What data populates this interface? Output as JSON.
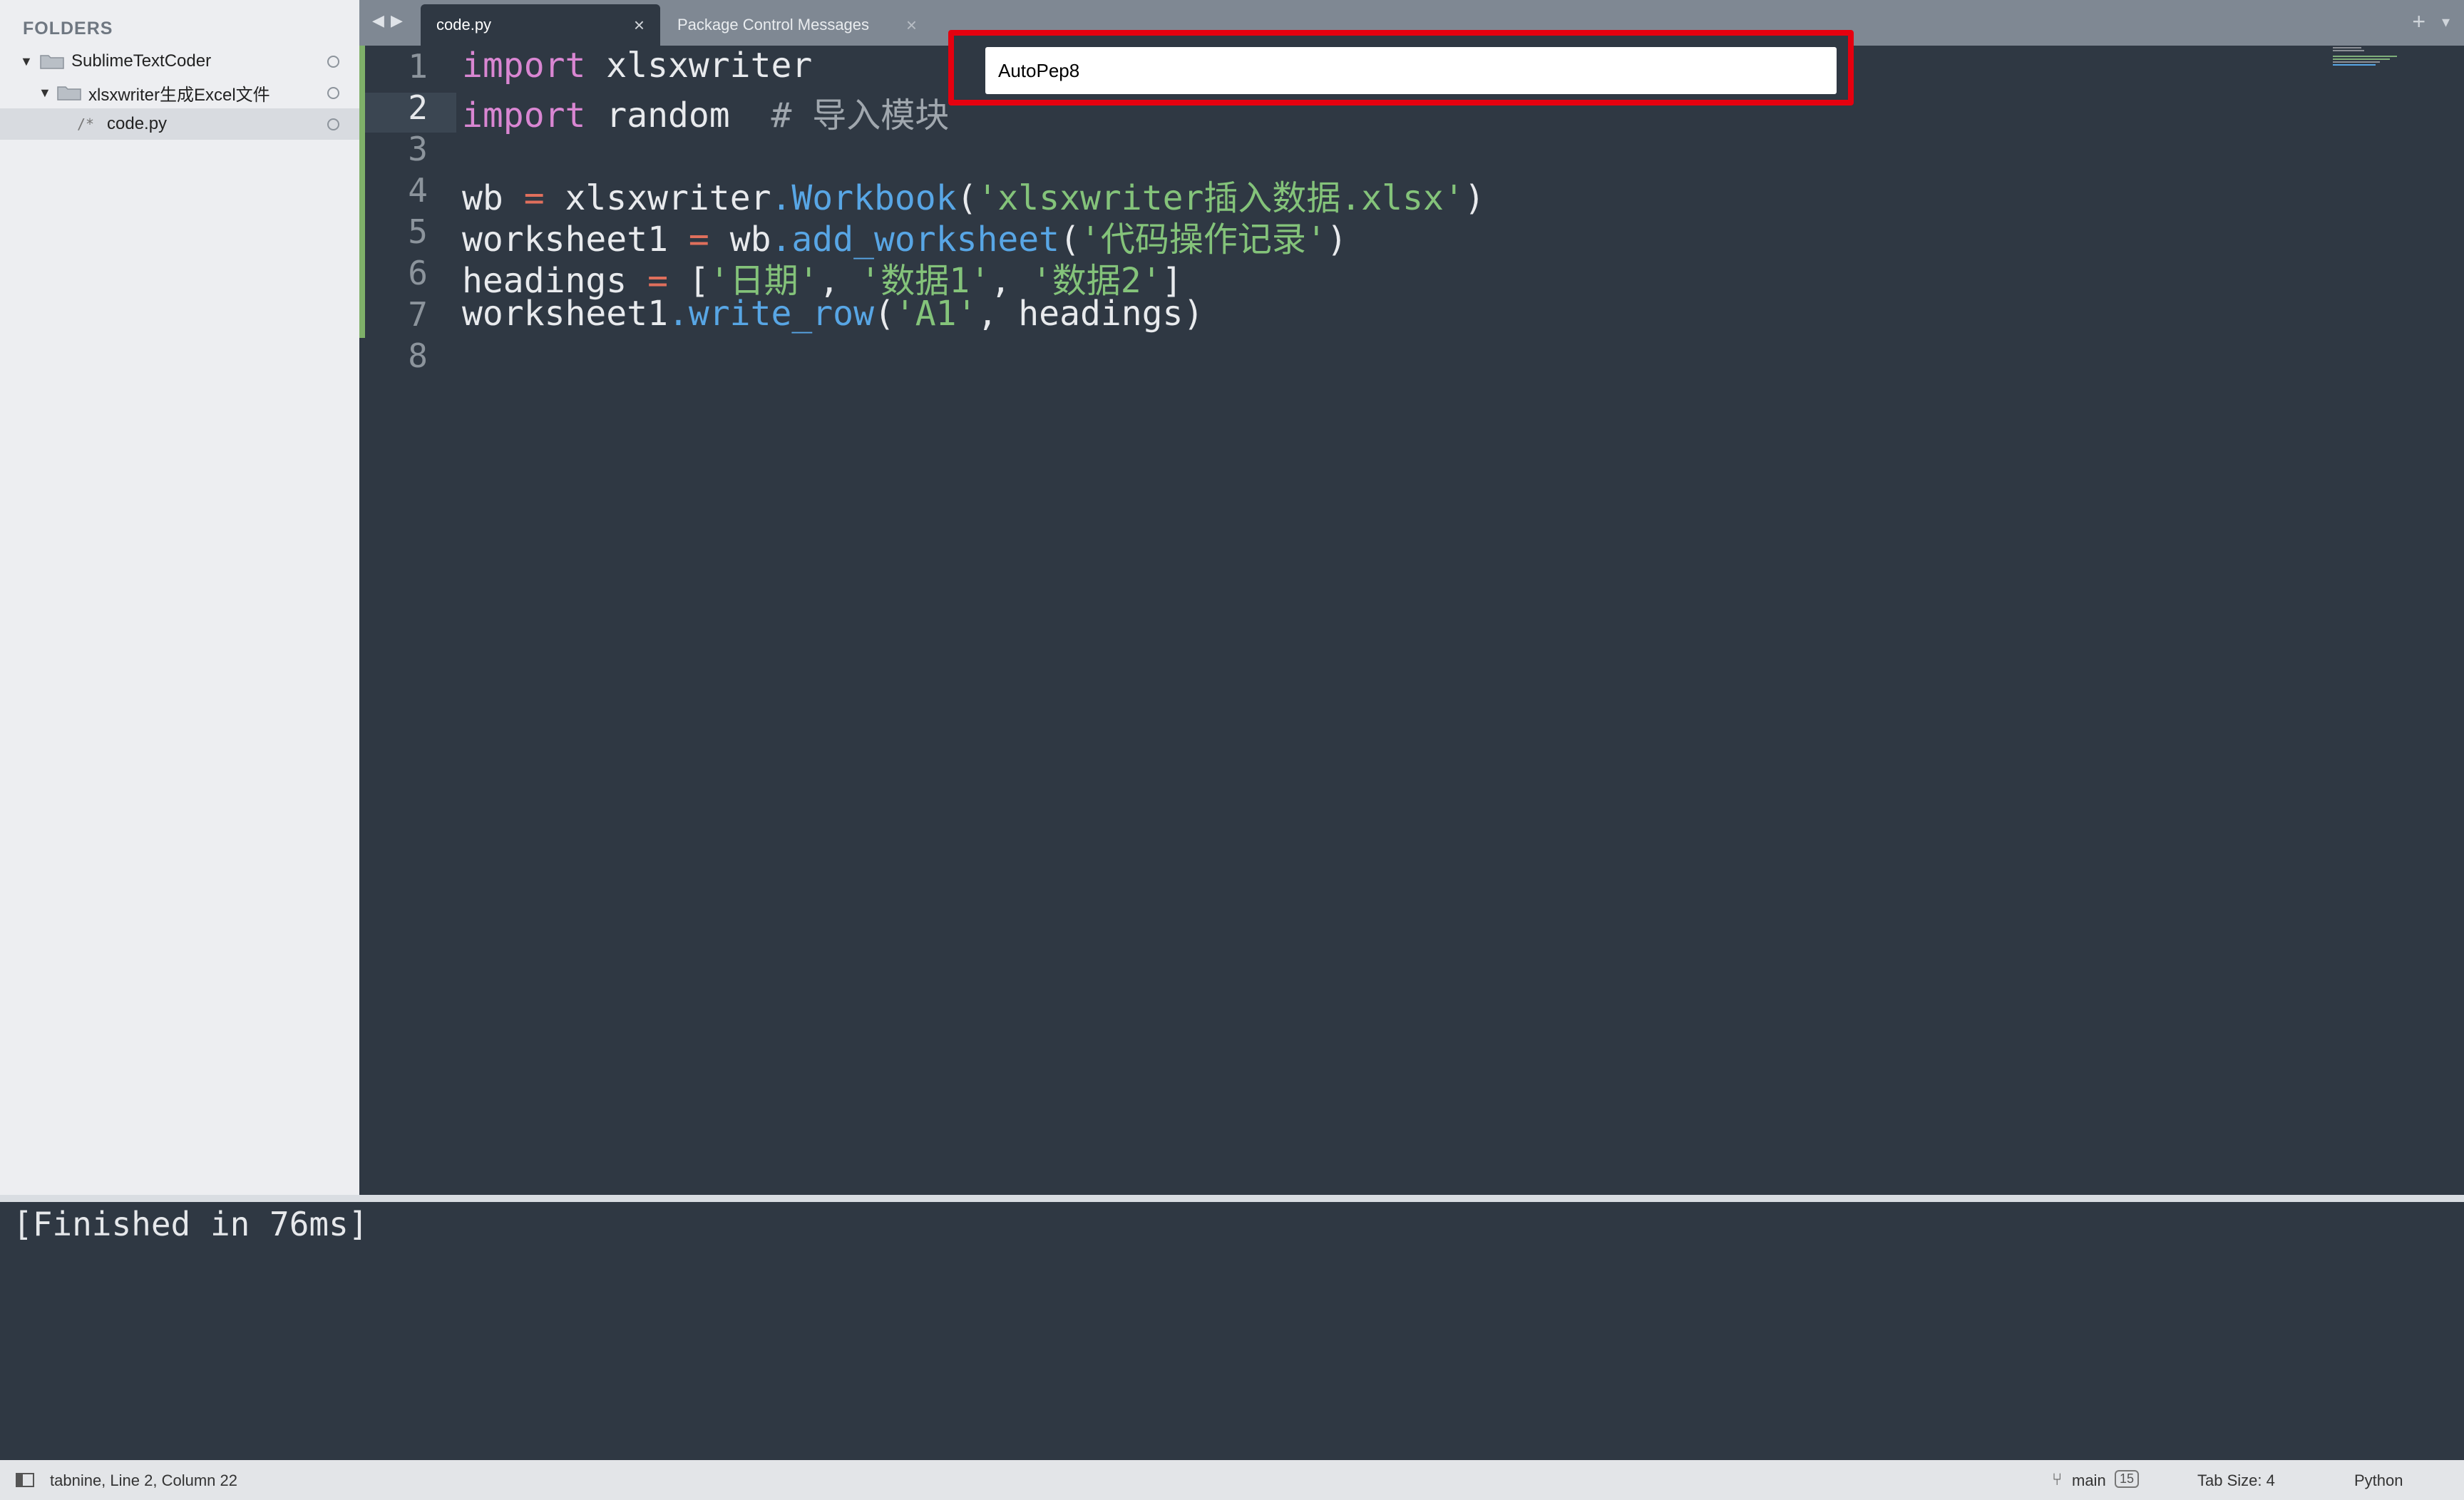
{
  "sidebar": {
    "header": "FOLDERS",
    "items": [
      {
        "label": "SublimeTextCoder",
        "type": "folder"
      },
      {
        "label": "xlsxwriter生成Excel文件",
        "type": "folder"
      },
      {
        "label": "code.py",
        "type": "file",
        "icon_text": "/*"
      }
    ]
  },
  "tabs": [
    {
      "label": "code.py",
      "active": true
    },
    {
      "label": "Package Control Messages",
      "active": false
    }
  ],
  "tabbar": {
    "close_glyph": "×",
    "plus_glyph": "+",
    "dropdown_glyph": "▾",
    "nav_left": "◀",
    "nav_right": "▶"
  },
  "editor": {
    "current_line": 2,
    "line_numbers": [
      "1",
      "2",
      "3",
      "4",
      "5",
      "6",
      "7",
      "8"
    ],
    "lines": [
      "import xlsxwriter",
      "import random  # 导入模块",
      "",
      "wb = xlsxwriter.Workbook('xlsxwriter插入数据.xlsx')",
      "worksheet1 = wb.add_worksheet('代码操作记录')",
      "headings = ['日期', '数据1', '数据2']",
      "worksheet1.write_row('A1', headings)",
      ""
    ]
  },
  "palette": {
    "value": "AutoPep8"
  },
  "output": {
    "text": "[Finished in 76ms]"
  },
  "status": {
    "left": "tabnine, Line 2, Column 22",
    "branch": "main",
    "count": "15",
    "tab_size": "Tab Size: 4",
    "syntax": "Python"
  },
  "colors": {
    "highlight_frame": "#e5000f",
    "keyword": "#d986d2",
    "function": "#58a6e5",
    "string": "#84c37a",
    "operator": "#e06f5c"
  }
}
